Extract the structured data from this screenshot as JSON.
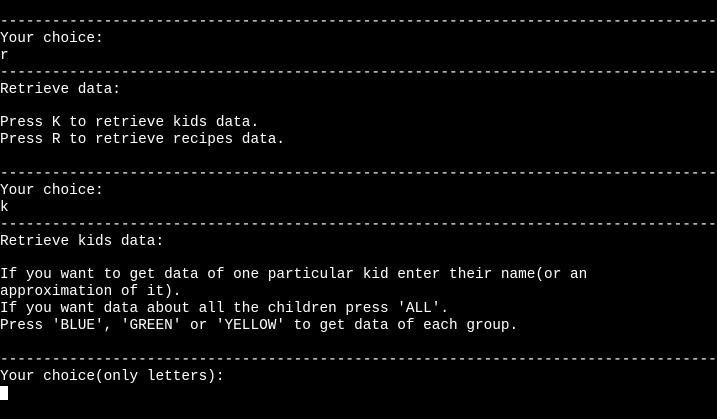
{
  "terminal": {
    "separator": "------------------------------------------------------------------------------------------------------------------------",
    "lines": [
      {
        "kind": "sep"
      },
      {
        "kind": "text",
        "text": "Your choice:"
      },
      {
        "kind": "text",
        "text": "r"
      },
      {
        "kind": "sep"
      },
      {
        "kind": "text",
        "text": "Retrieve data:"
      },
      {
        "kind": "text",
        "text": ""
      },
      {
        "kind": "text",
        "text": "Press K to retrieve kids data."
      },
      {
        "kind": "text",
        "text": "Press R to retrieve recipes data."
      },
      {
        "kind": "text",
        "text": ""
      },
      {
        "kind": "sep"
      },
      {
        "kind": "text",
        "text": "Your choice:"
      },
      {
        "kind": "text",
        "text": "k"
      },
      {
        "kind": "sep"
      },
      {
        "kind": "text",
        "text": "Retrieve kids data:"
      },
      {
        "kind": "text",
        "text": ""
      },
      {
        "kind": "text",
        "text": "If you want to get data of one particular kid enter their name(or an"
      },
      {
        "kind": "text",
        "text": "approximation of it)."
      },
      {
        "kind": "text",
        "text": "If you want data about all the children press 'ALL'."
      },
      {
        "kind": "text",
        "text": "Press 'BLUE', 'GREEN' or 'YELLOW' to get data of each group."
      },
      {
        "kind": "text",
        "text": ""
      },
      {
        "kind": "sep"
      },
      {
        "kind": "text",
        "text": "Your choice(only letters):"
      },
      {
        "kind": "input",
        "text": ""
      }
    ]
  },
  "colors": {
    "background": "#000000",
    "foreground": "#ffffff"
  }
}
